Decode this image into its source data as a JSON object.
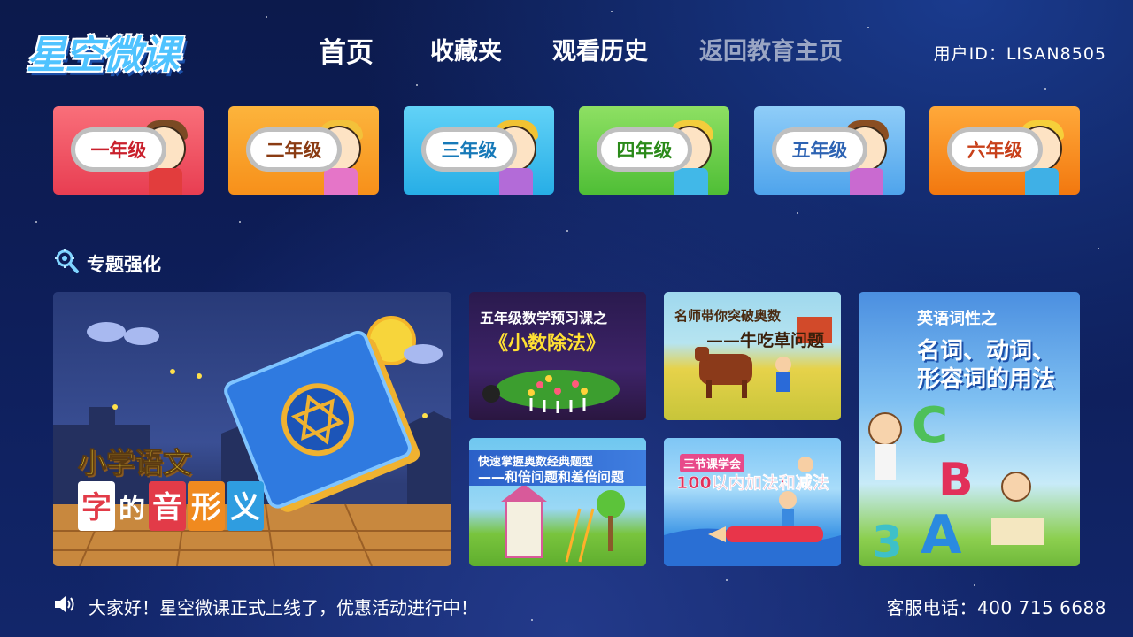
{
  "app": {
    "logo_text": "星空微课"
  },
  "nav": {
    "items": [
      {
        "label": "首页",
        "state": "active"
      },
      {
        "label": "收藏夹",
        "state": "normal"
      },
      {
        "label": "观看历史",
        "state": "normal"
      },
      {
        "label": "返回教育主页",
        "state": "muted"
      }
    ],
    "user_id": "用户ID：LISAN8505"
  },
  "grades": [
    {
      "label": "一年级",
      "bg": "#f25865",
      "text_color": "#c9202c"
    },
    {
      "label": "二年级",
      "bg": "#f9a21f",
      "text_color": "#8a3b12"
    },
    {
      "label": "三年级",
      "bg": "#43c3ef",
      "text_color": "#1679b8"
    },
    {
      "label": "四年级",
      "bg": "#6bd14a",
      "text_color": "#2b8a1a"
    },
    {
      "label": "五年级",
      "bg": "#69b6f2",
      "text_color": "#2d63b3"
    },
    {
      "label": "六年级",
      "bg": "#f78e1b",
      "text_color": "#c8401a"
    }
  ],
  "section": {
    "title": "专题强化",
    "icon": "magnifier-gear-icon"
  },
  "tiles": {
    "big": {
      "line1": "小学语文",
      "line2": [
        "字",
        "的",
        "音",
        "形",
        "义"
      ]
    },
    "t1": {
      "line1": "五年级数学预习课之",
      "line2": "《小数除法》"
    },
    "t2": {
      "line1": "名师带你突破奥数",
      "line2": "——牛吃草问题"
    },
    "t3": {
      "line1": "快速掌握奥数经典题型",
      "line2": "——和倍问题和差倍问题"
    },
    "t4": {
      "line1": "三节课学会",
      "line2": "100以内加法和减法"
    },
    "t5": {
      "line1": "英语词性之",
      "line2": "名词、动词、",
      "line3": "形容词的用法"
    }
  },
  "footer": {
    "announcement": "大家好！星空微课正式上线了，优惠活动进行中！",
    "hotline": "客服电话：400 715 6688",
    "speaker_icon": "speaker-icon"
  }
}
